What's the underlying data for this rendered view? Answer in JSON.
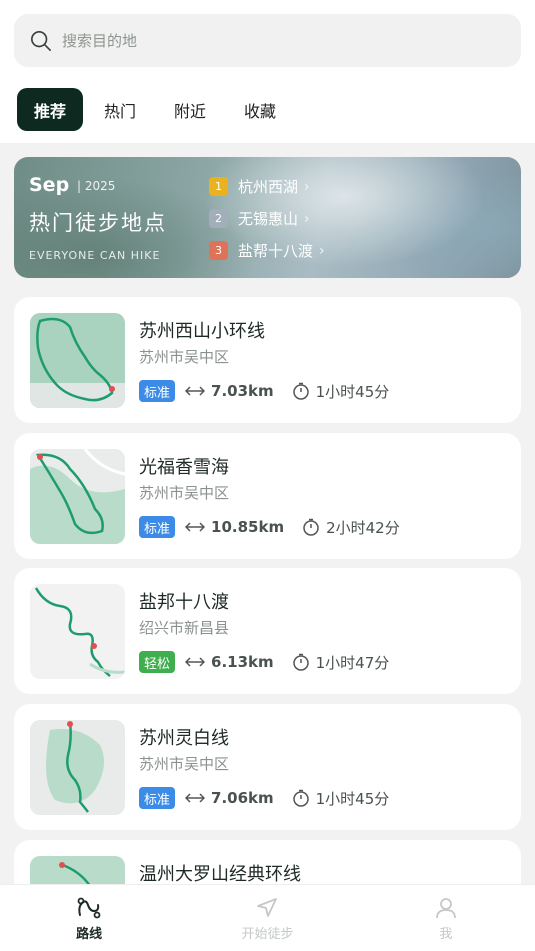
{
  "search": {
    "placeholder": "搜索目的地"
  },
  "tabs": [
    {
      "label": "推荐",
      "active": true
    },
    {
      "label": "热门",
      "active": false
    },
    {
      "label": "附近",
      "active": false
    },
    {
      "label": "收藏",
      "active": false
    }
  ],
  "banner": {
    "month": "Sep",
    "year": "2025",
    "title": "热门徒步地点",
    "subtitle": "EVERYONE CAN HIKE",
    "ranks": [
      {
        "num": "1",
        "name": "杭州西湖",
        "color": "#e9b21f"
      },
      {
        "num": "2",
        "name": "无锡惠山",
        "color": "#a3aebb"
      },
      {
        "num": "3",
        "name": "盐帮十八渡",
        "color": "#df7358"
      }
    ]
  },
  "routes": [
    {
      "name": "苏州西山小环线",
      "region": "苏州市吴中区",
      "level": "标准",
      "level_color": "#3c8ce7",
      "distance": "7.03km",
      "duration": "1小时45分"
    },
    {
      "name": "光福香雪海",
      "region": "苏州市吴中区",
      "level": "标准",
      "level_color": "#3c8ce7",
      "distance": "10.85km",
      "duration": "2小时42分"
    },
    {
      "name": "盐邦十八渡",
      "region": "绍兴市新昌县",
      "level": "轻松",
      "level_color": "#3fae4e",
      "distance": "6.13km",
      "duration": "1小时47分"
    },
    {
      "name": "苏州灵白线",
      "region": "苏州市吴中区",
      "level": "标准",
      "level_color": "#3c8ce7",
      "distance": "7.06km",
      "duration": "1小时45分"
    },
    {
      "name": "温州大罗山经典环线",
      "region": "",
      "level": "",
      "level_color": "",
      "distance": "",
      "duration": ""
    }
  ],
  "nav": [
    {
      "label": "路线",
      "icon": "route-icon",
      "active": true
    },
    {
      "label": "开始徒步",
      "icon": "navigate-icon",
      "active": false
    },
    {
      "label": "我",
      "icon": "user-icon",
      "active": false
    }
  ]
}
